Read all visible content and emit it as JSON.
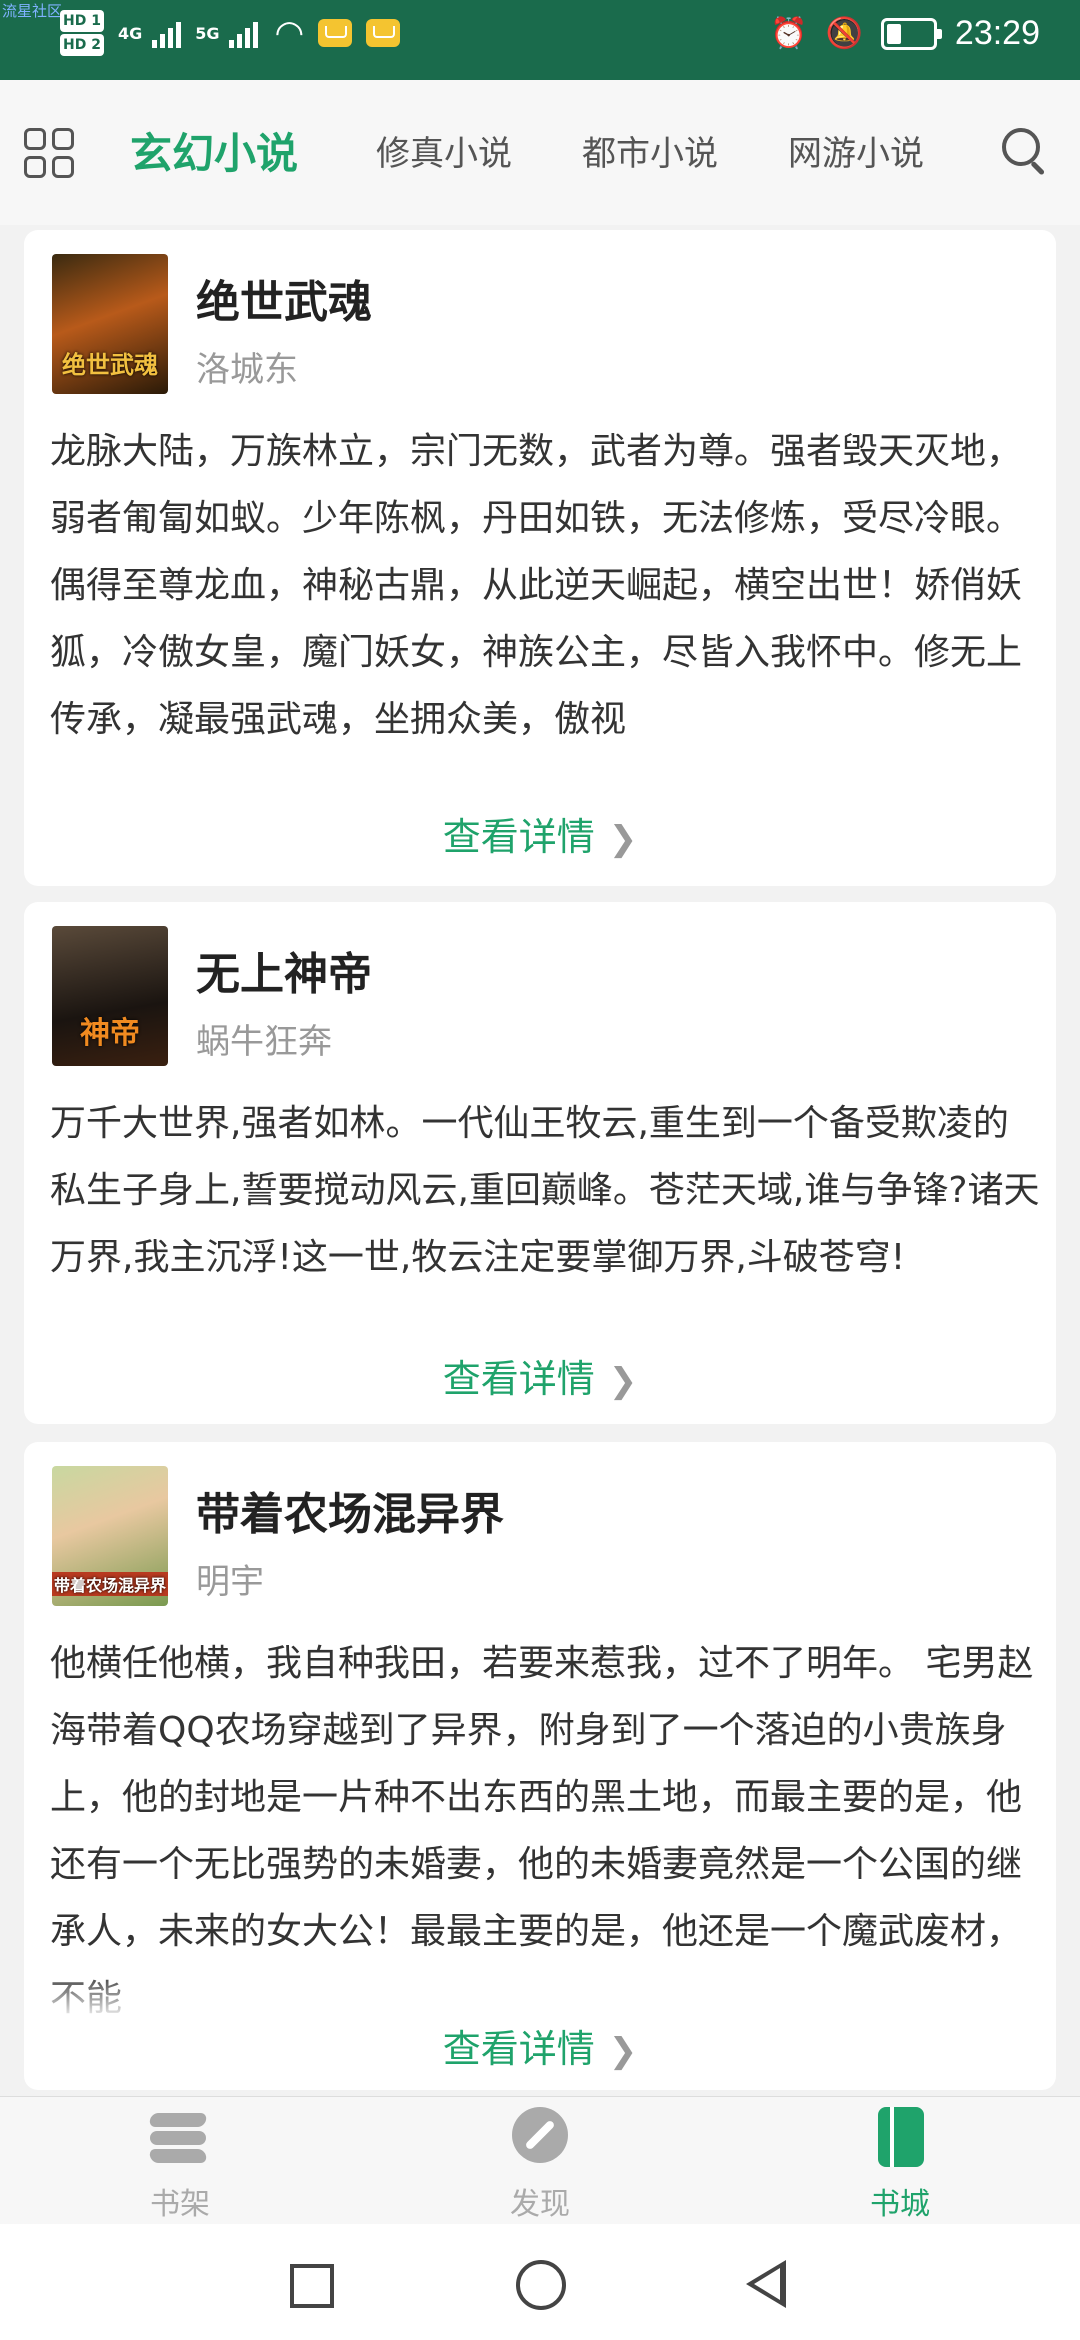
{
  "status_bar": {
    "watermark": "流星社区",
    "hd1": "HD 1",
    "hd2": "HD 2",
    "net1": "4G",
    "net2": "5G",
    "time": "23:29"
  },
  "nav": {
    "tabs": [
      "玄幻小说",
      "修真小说",
      "都市小说",
      "网游小说"
    ],
    "active_tab": 0
  },
  "books": [
    {
      "title": "绝世武魂",
      "author": "洛城东",
      "cover_text": "绝世武魂",
      "description": "龙脉大陆，万族林立，宗门无数，武者为尊。强者毁天灭地，弱者匍匐如蚁。少年陈枫，丹田如铁，无法修炼，受尽冷眼。偶得至尊龙血，神秘古鼎，从此逆天崛起，横空出世！娇俏妖狐，冷傲女皇，魔门妖女，神族公主，尽皆入我怀中。修无上传承，凝最强武魂，坐拥众美，傲视",
      "more_label": "查看详情"
    },
    {
      "title": "无上神帝",
      "author": "蜗牛狂奔",
      "cover_text": "神帝",
      "description": "万千大世界,强者如林。一代仙王牧云,重生到一个备受欺凌的私生子身上,誓要搅动风云,重回巅峰。苍茫天域,谁与争锋?诸天万界,我主沉浮!这一世,牧云注定要掌御万界,斗破苍穹!",
      "more_label": "查看详情"
    },
    {
      "title": "带着农场混异界",
      "author": "明宇",
      "cover_text": "带着农场混异界",
      "description": "他横任他横，我自种我田，若要来惹我，过不了明年。 宅男赵海带着QQ农场穿越到了异界，附身到了一个落迫的小贵族身上，他的封地是一片种不出东西的黑土地，而最主要的是，他还有一个无比强势的未婚妻，他的未婚妻竟然是一个公国的继承人，未来的女大公！最最主要的是，他还是一个魔武废材，不能",
      "more_label": "查看详情"
    }
  ],
  "bottom_tabs": [
    "书架",
    "发现",
    "书城"
  ],
  "active_bottom_tab": 2,
  "colors": {
    "status_bar": "#1a6b4c",
    "accent": "#1fa36b"
  }
}
